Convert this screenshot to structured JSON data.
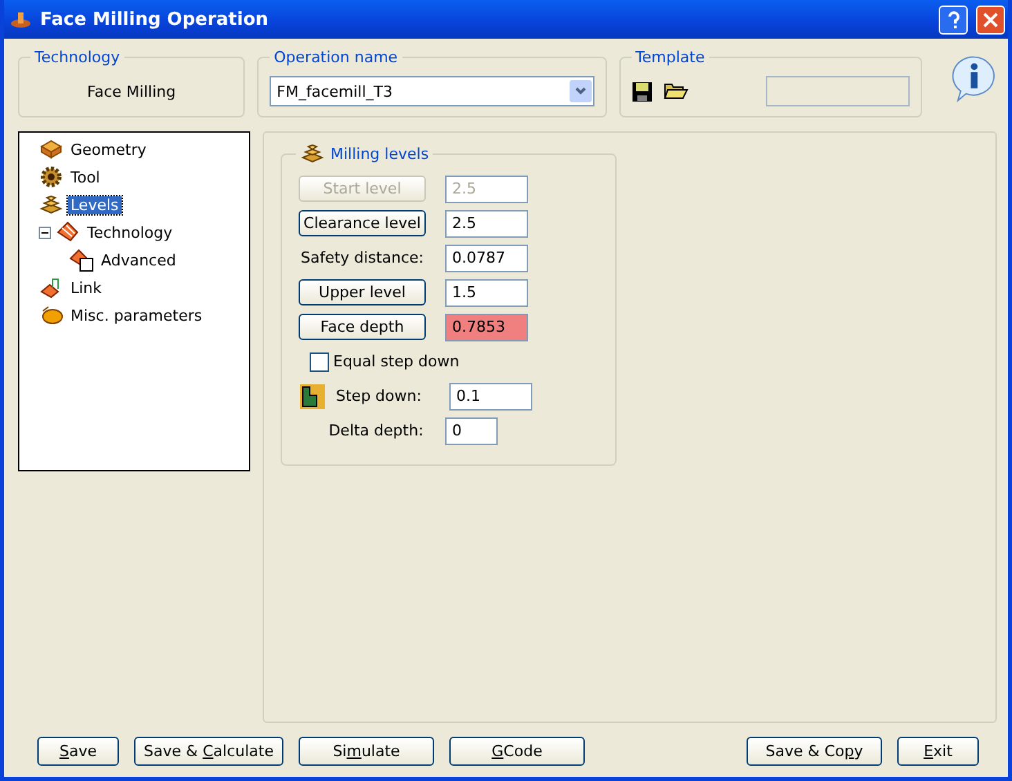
{
  "window": {
    "title": "Face Milling Operation"
  },
  "technology": {
    "legend": "Technology",
    "value": "Face Milling"
  },
  "operation_name": {
    "legend": "Operation name",
    "value": "FM_facemill_T3"
  },
  "template": {
    "legend": "Template"
  },
  "tree": [
    {
      "label": "Geometry",
      "kind": "geometry",
      "selected": false
    },
    {
      "label": "Tool",
      "kind": "tool",
      "selected": false
    },
    {
      "label": "Levels",
      "kind": "levels",
      "selected": true
    },
    {
      "label": "Technology",
      "kind": "technology",
      "selected": false,
      "expanded": true,
      "children": [
        {
          "label": "Advanced",
          "kind": "advanced",
          "selected": false
        }
      ]
    },
    {
      "label": "Link",
      "kind": "link",
      "selected": false
    },
    {
      "label": "Misc. parameters",
      "kind": "misc",
      "selected": false
    }
  ],
  "milling_levels": {
    "legend": "Milling levels",
    "rows": [
      {
        "kind": "button",
        "label": "Start level",
        "value": "2.5",
        "disabled": true,
        "warning": false
      },
      {
        "kind": "button",
        "label": "Clearance level",
        "value": "2.5",
        "disabled": false,
        "warning": false
      },
      {
        "kind": "label",
        "label": "Safety distance:",
        "value": "0.0787",
        "disabled": false,
        "warning": false
      },
      {
        "kind": "button",
        "label": "Upper level",
        "value": "1.5",
        "disabled": false,
        "warning": false
      },
      {
        "kind": "button",
        "label": "Face depth",
        "value": "0.7853",
        "disabled": false,
        "warning": true
      },
      {
        "kind": "checkbox",
        "label": "Equal step down",
        "checked": false
      },
      {
        "kind": "icon_label",
        "label": "Step down:",
        "value": "0.1",
        "disabled": false,
        "warning": false
      },
      {
        "kind": "small_label",
        "label": "Delta depth:",
        "value": "0",
        "disabled": false,
        "warning": false
      }
    ]
  },
  "buttons_left": [
    {
      "key": "S",
      "post": "ave"
    },
    {
      "pre": "Save & ",
      "key": "C",
      "post": "alculate"
    },
    {
      "pre": "Si",
      "key": "m",
      "post": "ulate"
    },
    {
      "key": "G",
      "post": "Code"
    }
  ],
  "buttons_right": [
    {
      "pre": "Save & Co",
      "key": "p",
      "post": "y"
    },
    {
      "key": "E",
      "post": "xit"
    }
  ]
}
